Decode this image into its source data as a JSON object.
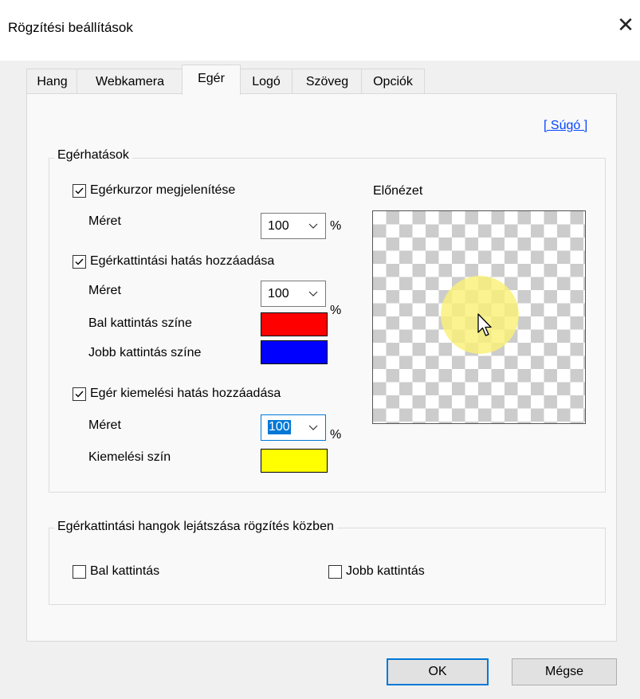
{
  "window": {
    "title": "Rögzítési beállítások",
    "close_glyph": "✕"
  },
  "tabs": [
    {
      "label": "Hang"
    },
    {
      "label": "Webkamera"
    },
    {
      "label": "Egér",
      "active": true
    },
    {
      "label": "Logó"
    },
    {
      "label": "Szöveg"
    },
    {
      "label": "Opciók"
    }
  ],
  "help_link": "[ Súgó ]",
  "effects": {
    "title": "Egérhatások",
    "cursor": {
      "label": "Egérkurzor megjelenítése",
      "checked": true,
      "size_label": "Méret",
      "size_value": "100",
      "unit": "%"
    },
    "click": {
      "label": "Egérkattintási hatás hozzáadása",
      "checked": true,
      "size_label": "Méret",
      "size_value": "100",
      "unit": "%",
      "left_label": "Bal kattintás színe",
      "left_color": "#ff0000",
      "right_label": "Jobb kattintás színe",
      "right_color": "#0000ff"
    },
    "highlight": {
      "label": "Egér kiemelési hatás hozzáadása",
      "checked": true,
      "size_label": "Méret",
      "size_value": "100",
      "unit": "%",
      "color_label": "Kiemelési szín",
      "color": "#ffff00"
    },
    "preview_label": "Előnézet"
  },
  "sounds": {
    "title": "Egérkattintási hangok lejátszása rögzítés közben",
    "left": {
      "label": "Bal kattintás",
      "checked": false
    },
    "right": {
      "label": "Jobb kattintás",
      "checked": false
    }
  },
  "buttons": {
    "ok": "OK",
    "cancel": "Mégse"
  },
  "colors": {
    "accent": "#0078d7",
    "link": "#0645ff"
  }
}
